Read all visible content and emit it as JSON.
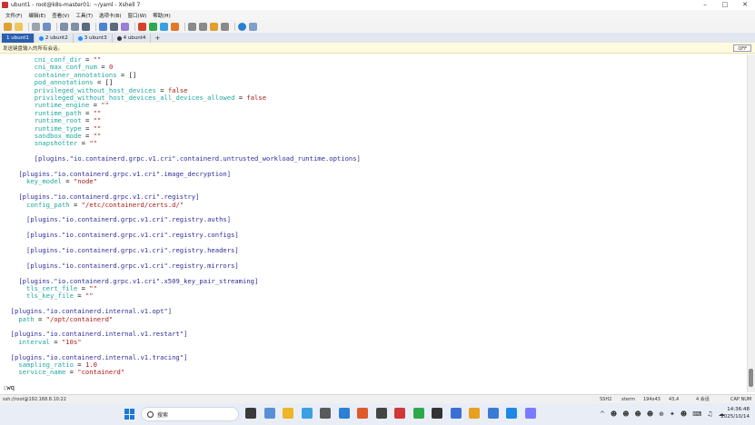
{
  "window": {
    "title": "ubunt1 - root@k8s-master01: ~/yaml - Xshell 7",
    "controls": [
      "–",
      "□",
      "✕"
    ]
  },
  "menu": [
    "文件(F)",
    "编辑(E)",
    "查看(V)",
    "工具(T)",
    "选项卡(B)",
    "窗口(W)",
    "帮助(H)"
  ],
  "tabs": [
    {
      "label": "1 ubunt1",
      "active": true,
      "dot": "#2a5fae"
    },
    {
      "label": "2 ubunt2",
      "active": false,
      "dot": "#1e90ff"
    },
    {
      "label": "3 ubunt3",
      "active": false,
      "dot": "#1e90ff"
    },
    {
      "label": "4 ubunt4",
      "active": false,
      "dot": "#333333"
    }
  ],
  "tab_add": "+",
  "notice": {
    "text": "发送键盘输入的所有会话。",
    "off_label": "OFF"
  },
  "terminal_lines": [
    {
      "indent": 8,
      "segs": [
        {
          "t": "cni_conf_dir",
          "c": "key"
        },
        {
          "t": " = ",
          "c": "plain"
        },
        {
          "t": "\"\"",
          "c": "val"
        }
      ]
    },
    {
      "indent": 8,
      "segs": [
        {
          "t": "cni_max_conf_num",
          "c": "key"
        },
        {
          "t": " = ",
          "c": "plain"
        },
        {
          "t": "0",
          "c": "val"
        }
      ]
    },
    {
      "indent": 8,
      "segs": [
        {
          "t": "container_annotations",
          "c": "key"
        },
        {
          "t": " = ",
          "c": "plain"
        },
        {
          "t": "[]",
          "c": "plain"
        }
      ]
    },
    {
      "indent": 8,
      "segs": [
        {
          "t": "pod_annotations",
          "c": "key"
        },
        {
          "t": " = ",
          "c": "plain"
        },
        {
          "t": "[]",
          "c": "plain"
        }
      ]
    },
    {
      "indent": 8,
      "segs": [
        {
          "t": "privileged_without_host_devices",
          "c": "key"
        },
        {
          "t": " = ",
          "c": "plain"
        },
        {
          "t": "false",
          "c": "val"
        }
      ]
    },
    {
      "indent": 8,
      "segs": [
        {
          "t": "privileged_without_host_devices_all_devices_allowed",
          "c": "key"
        },
        {
          "t": " = ",
          "c": "plain"
        },
        {
          "t": "false",
          "c": "val"
        }
      ]
    },
    {
      "indent": 8,
      "segs": [
        {
          "t": "runtime_engine",
          "c": "key"
        },
        {
          "t": " = ",
          "c": "plain"
        },
        {
          "t": "\"\"",
          "c": "val"
        }
      ]
    },
    {
      "indent": 8,
      "segs": [
        {
          "t": "runtime_path",
          "c": "key"
        },
        {
          "t": " = ",
          "c": "plain"
        },
        {
          "t": "\"\"",
          "c": "val"
        }
      ]
    },
    {
      "indent": 8,
      "segs": [
        {
          "t": "runtime_root",
          "c": "key"
        },
        {
          "t": " = ",
          "c": "plain"
        },
        {
          "t": "\"\"",
          "c": "val"
        }
      ]
    },
    {
      "indent": 8,
      "segs": [
        {
          "t": "runtime_type",
          "c": "key"
        },
        {
          "t": " = ",
          "c": "plain"
        },
        {
          "t": "\"\"",
          "c": "val"
        }
      ]
    },
    {
      "indent": 8,
      "segs": [
        {
          "t": "sandbox_mode",
          "c": "key"
        },
        {
          "t": " = ",
          "c": "plain"
        },
        {
          "t": "\"\"",
          "c": "val"
        }
      ]
    },
    {
      "indent": 8,
      "segs": [
        {
          "t": "snapshotter",
          "c": "key"
        },
        {
          "t": " = ",
          "c": "plain"
        },
        {
          "t": "\"\"",
          "c": "val"
        }
      ]
    },
    {
      "indent": 0,
      "segs": []
    },
    {
      "indent": 8,
      "segs": [
        {
          "t": "[plugins.\"io.containerd.grpc.v1.cri\".containerd.untrusted_workload_runtime.options]",
          "c": "sec"
        }
      ]
    },
    {
      "indent": 0,
      "segs": []
    },
    {
      "indent": 4,
      "segs": [
        {
          "t": "[plugins.\"io.containerd.grpc.v1.cri\".image_decryption]",
          "c": "sec"
        }
      ]
    },
    {
      "indent": 6,
      "segs": [
        {
          "t": "key_model",
          "c": "key"
        },
        {
          "t": " = ",
          "c": "plain"
        },
        {
          "t": "\"node\"",
          "c": "val"
        }
      ]
    },
    {
      "indent": 0,
      "segs": []
    },
    {
      "indent": 4,
      "segs": [
        {
          "t": "[plugins.\"io.containerd.grpc.v1.cri\".registry]",
          "c": "sec"
        }
      ]
    },
    {
      "indent": 6,
      "segs": [
        {
          "t": "config_path",
          "c": "key"
        },
        {
          "t": " = ",
          "c": "plain"
        },
        {
          "t": "\"/etc/containerd/certs.d/\"",
          "c": "val"
        }
      ]
    },
    {
      "indent": 0,
      "segs": []
    },
    {
      "indent": 6,
      "segs": [
        {
          "t": "[plugins.\"io.containerd.grpc.v1.cri\".registry.auths]",
          "c": "sec"
        }
      ]
    },
    {
      "indent": 0,
      "segs": []
    },
    {
      "indent": 6,
      "segs": [
        {
          "t": "[plugins.\"io.containerd.grpc.v1.cri\".registry.configs]",
          "c": "sec"
        }
      ]
    },
    {
      "indent": 0,
      "segs": []
    },
    {
      "indent": 6,
      "segs": [
        {
          "t": "[plugins.\"io.containerd.grpc.v1.cri\".registry.headers]",
          "c": "sec"
        }
      ]
    },
    {
      "indent": 0,
      "segs": []
    },
    {
      "indent": 6,
      "segs": [
        {
          "t": "[plugins.\"io.containerd.grpc.v1.cri\".registry.mirrors]",
          "c": "sec"
        }
      ]
    },
    {
      "indent": 0,
      "segs": []
    },
    {
      "indent": 4,
      "segs": [
        {
          "t": "[plugins.\"io.containerd.grpc.v1.cri\".x509_key_pair_streaming]",
          "c": "sec"
        }
      ]
    },
    {
      "indent": 6,
      "segs": [
        {
          "t": "tls_cert_file",
          "c": "key"
        },
        {
          "t": " = ",
          "c": "plain"
        },
        {
          "t": "\"\"",
          "c": "val"
        }
      ]
    },
    {
      "indent": 6,
      "segs": [
        {
          "t": "tls_key_file",
          "c": "key"
        },
        {
          "t": " = ",
          "c": "plain"
        },
        {
          "t": "\"\"",
          "c": "val"
        }
      ]
    },
    {
      "indent": 0,
      "segs": []
    },
    {
      "indent": 2,
      "segs": [
        {
          "t": "[plugins.\"io.containerd.internal.v1.opt\"]",
          "c": "sec"
        }
      ]
    },
    {
      "indent": 4,
      "segs": [
        {
          "t": "path",
          "c": "key"
        },
        {
          "t": " = ",
          "c": "plain"
        },
        {
          "t": "\"/opt/containerd\"",
          "c": "val"
        }
      ]
    },
    {
      "indent": 0,
      "segs": []
    },
    {
      "indent": 2,
      "segs": [
        {
          "t": "[plugins.\"io.containerd.internal.v1.restart\"]",
          "c": "sec"
        }
      ]
    },
    {
      "indent": 4,
      "segs": [
        {
          "t": "interval",
          "c": "key"
        },
        {
          "t": " = ",
          "c": "plain"
        },
        {
          "t": "\"10s\"",
          "c": "val"
        }
      ]
    },
    {
      "indent": 0,
      "segs": []
    },
    {
      "indent": 2,
      "segs": [
        {
          "t": "[plugins.\"io.containerd.internal.v1.tracing\"]",
          "c": "sec"
        }
      ]
    },
    {
      "indent": 4,
      "segs": [
        {
          "t": "sampling_ratio",
          "c": "key"
        },
        {
          "t": " = ",
          "c": "plain"
        },
        {
          "t": "1.0",
          "c": "val"
        }
      ]
    },
    {
      "indent": 4,
      "segs": [
        {
          "t": "service_name",
          "c": "key"
        },
        {
          "t": " = ",
          "c": "plain"
        },
        {
          "t": "\"containerd\"",
          "c": "val"
        }
      ]
    },
    {
      "indent": 0,
      "segs": []
    },
    {
      "indent": 0,
      "segs": [
        {
          "t": ":wq",
          "c": "plain"
        }
      ]
    }
  ],
  "status": {
    "connection": "ssh://root@192.168.8.10:22",
    "protocol": "SSH2",
    "term": "xterm",
    "size": "194x43",
    "cursor": "43,4",
    "sessions": "4 会话",
    "caps": "CAP NUM"
  },
  "taskbar": {
    "search_label": "搜索",
    "time": "14:36:48",
    "date": "2025/10/14",
    "app_colors": [
      "#3a3a3a",
      "#5a8fd6",
      "#f0b429",
      "#3aa0e0",
      "#5a5a5a",
      "#2b7fd4",
      "#e05a2b",
      "#444444",
      "#d03838",
      "#2ea84c",
      "#333333",
      "#3b6fd4",
      "#e8a020",
      "#3a7bd5",
      "#1e88e5",
      "#7a7aff"
    ],
    "tray_glyphs": [
      "^",
      "☻",
      "☻",
      "☻",
      "☻",
      "⊕",
      "✦",
      "☻",
      "⌨",
      "♫",
      "☁"
    ]
  },
  "colors": {
    "key": "#20a8a0",
    "value": "#b01818",
    "section": "#2d2d9c",
    "active_tab": "#2a5fae"
  }
}
